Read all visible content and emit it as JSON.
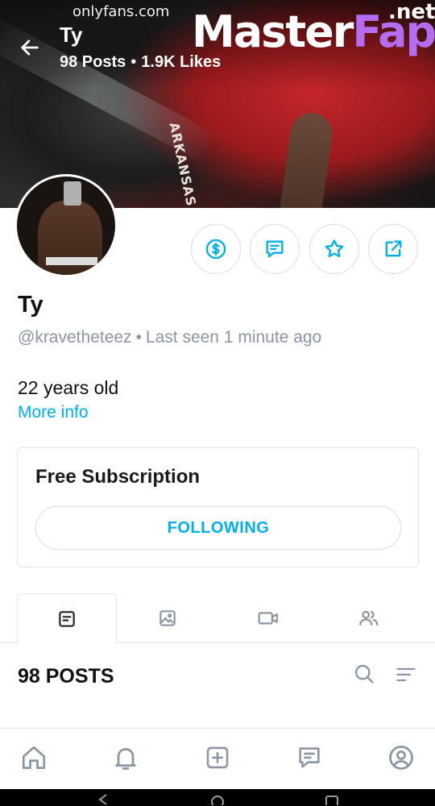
{
  "watermark": {
    "site": "onlyfans.com",
    "logo_part1": "Master",
    "logo_part2": "Fap",
    "logo_suffix": ".net"
  },
  "header": {
    "back_icon": "arrow-left-icon",
    "name": "Ty",
    "posts_stat": "98 Posts",
    "separator": "•",
    "likes_stat": "1.9K Likes",
    "banner_print": "ARKANSAS"
  },
  "actions": [
    {
      "icon": "dollar-tip-icon"
    },
    {
      "icon": "message-icon"
    },
    {
      "icon": "star-icon"
    },
    {
      "icon": "share-icon"
    }
  ],
  "profile": {
    "name": "Ty",
    "handle": "@kravetheteez",
    "separator": "•",
    "last_seen": "Last seen 1 minute ago",
    "age": "22 years old",
    "more_info": "More info"
  },
  "subscription": {
    "title": "Free Subscription",
    "button_label": "FOLLOWING"
  },
  "tabs": [
    {
      "icon": "posts-icon",
      "active": true
    },
    {
      "icon": "photos-icon",
      "active": false
    },
    {
      "icon": "videos-icon",
      "active": false
    },
    {
      "icon": "friends-icon",
      "active": false
    }
  ],
  "posts": {
    "count_label": "98 POSTS"
  },
  "bottom_nav": [
    {
      "icon": "home-icon"
    },
    {
      "icon": "bell-icon"
    },
    {
      "icon": "add-post-icon"
    },
    {
      "icon": "chat-icon"
    },
    {
      "icon": "profile-icon"
    }
  ],
  "colors": {
    "accent": "#00aff0",
    "muted_text": "#8a96a3",
    "icon_gray": "#8a96a3",
    "border": "#dfe3e8",
    "logo_accent": "#b46cf0"
  }
}
